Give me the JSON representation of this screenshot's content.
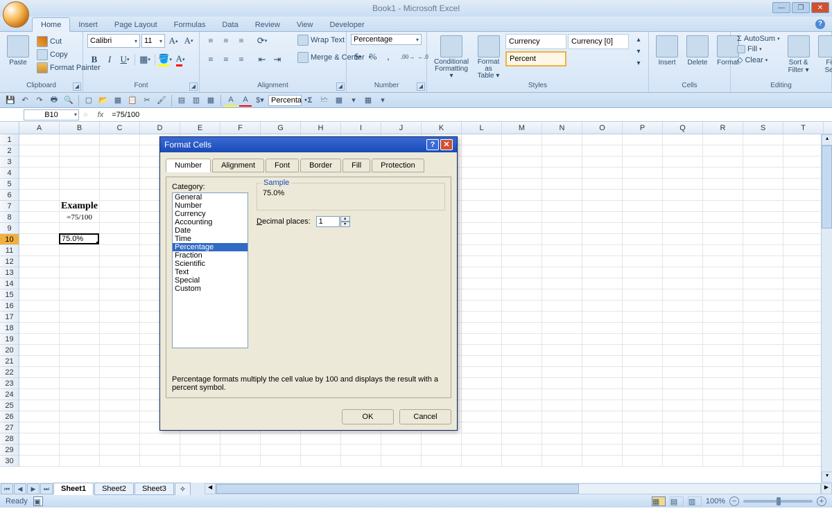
{
  "title": "Book1 - Microsoft Excel",
  "tabs": [
    "Home",
    "Insert",
    "Page Layout",
    "Formulas",
    "Data",
    "Review",
    "View",
    "Developer"
  ],
  "activeTab": "Home",
  "ribbon": {
    "clipboard": {
      "label": "Clipboard",
      "paste": "Paste",
      "cut": "Cut",
      "copy": "Copy",
      "painter": "Format Painter"
    },
    "font": {
      "label": "Font",
      "name": "Calibri",
      "size": "11"
    },
    "alignment": {
      "label": "Alignment",
      "wrap": "Wrap Text",
      "merge": "Merge & Center"
    },
    "number": {
      "label": "Number",
      "format": "Percentage"
    },
    "styles": {
      "label": "Styles",
      "cond": "Conditional\nFormatting",
      "table": "Format as\nTable",
      "items": [
        "Currency",
        "Currency [0]",
        "Percent"
      ]
    },
    "cells": {
      "label": "Cells",
      "insert": "Insert",
      "delete": "Delete",
      "format": "Format"
    },
    "editing": {
      "label": "Editing",
      "autosum": "AutoSum",
      "fill": "Fill",
      "clear": "Clear",
      "sort": "Sort &\nFilter",
      "find": "Fi\nSe"
    }
  },
  "qat_format": "Percenta",
  "namebox": "B10",
  "formula": "=75/100",
  "columns": [
    "A",
    "B",
    "C",
    "D",
    "E",
    "F",
    "G",
    "H",
    "I",
    "J",
    "K",
    "L",
    "M",
    "N",
    "O",
    "P",
    "Q",
    "R",
    "S",
    "T"
  ],
  "rows": 30,
  "cells": {
    "B7": {
      "text": "Example",
      "style": "font-weight:bold;font-family:'Times New Roman',serif;font-size:14px;text-align:center;overflow:visible"
    },
    "B8": {
      "text": "=75/100",
      "style": "text-align:center;font-family:'Times New Roman',serif"
    },
    "B10": {
      "text": "75.0%",
      "style": "text-align:right",
      "selected": true
    }
  },
  "sheets": [
    "Sheet1",
    "Sheet2",
    "Sheet3"
  ],
  "activeSheet": "Sheet1",
  "status": "Ready",
  "zoom": "100%",
  "dialog": {
    "title": "Format Cells",
    "tabs": [
      "Number",
      "Alignment",
      "Font",
      "Border",
      "Fill",
      "Protection"
    ],
    "activeTab": "Number",
    "categoryLabel": "Category:",
    "categories": [
      "General",
      "Number",
      "Currency",
      "Accounting",
      "Date",
      "Time",
      "Percentage",
      "Fraction",
      "Scientific",
      "Text",
      "Special",
      "Custom"
    ],
    "selectedCategory": "Percentage",
    "sampleLabel": "Sample",
    "sampleValue": "75.0%",
    "decimalLabel": "Decimal places:",
    "decimalValue": "1",
    "description": "Percentage formats multiply the cell value by 100 and displays the result with a percent symbol.",
    "ok": "OK",
    "cancel": "Cancel"
  }
}
